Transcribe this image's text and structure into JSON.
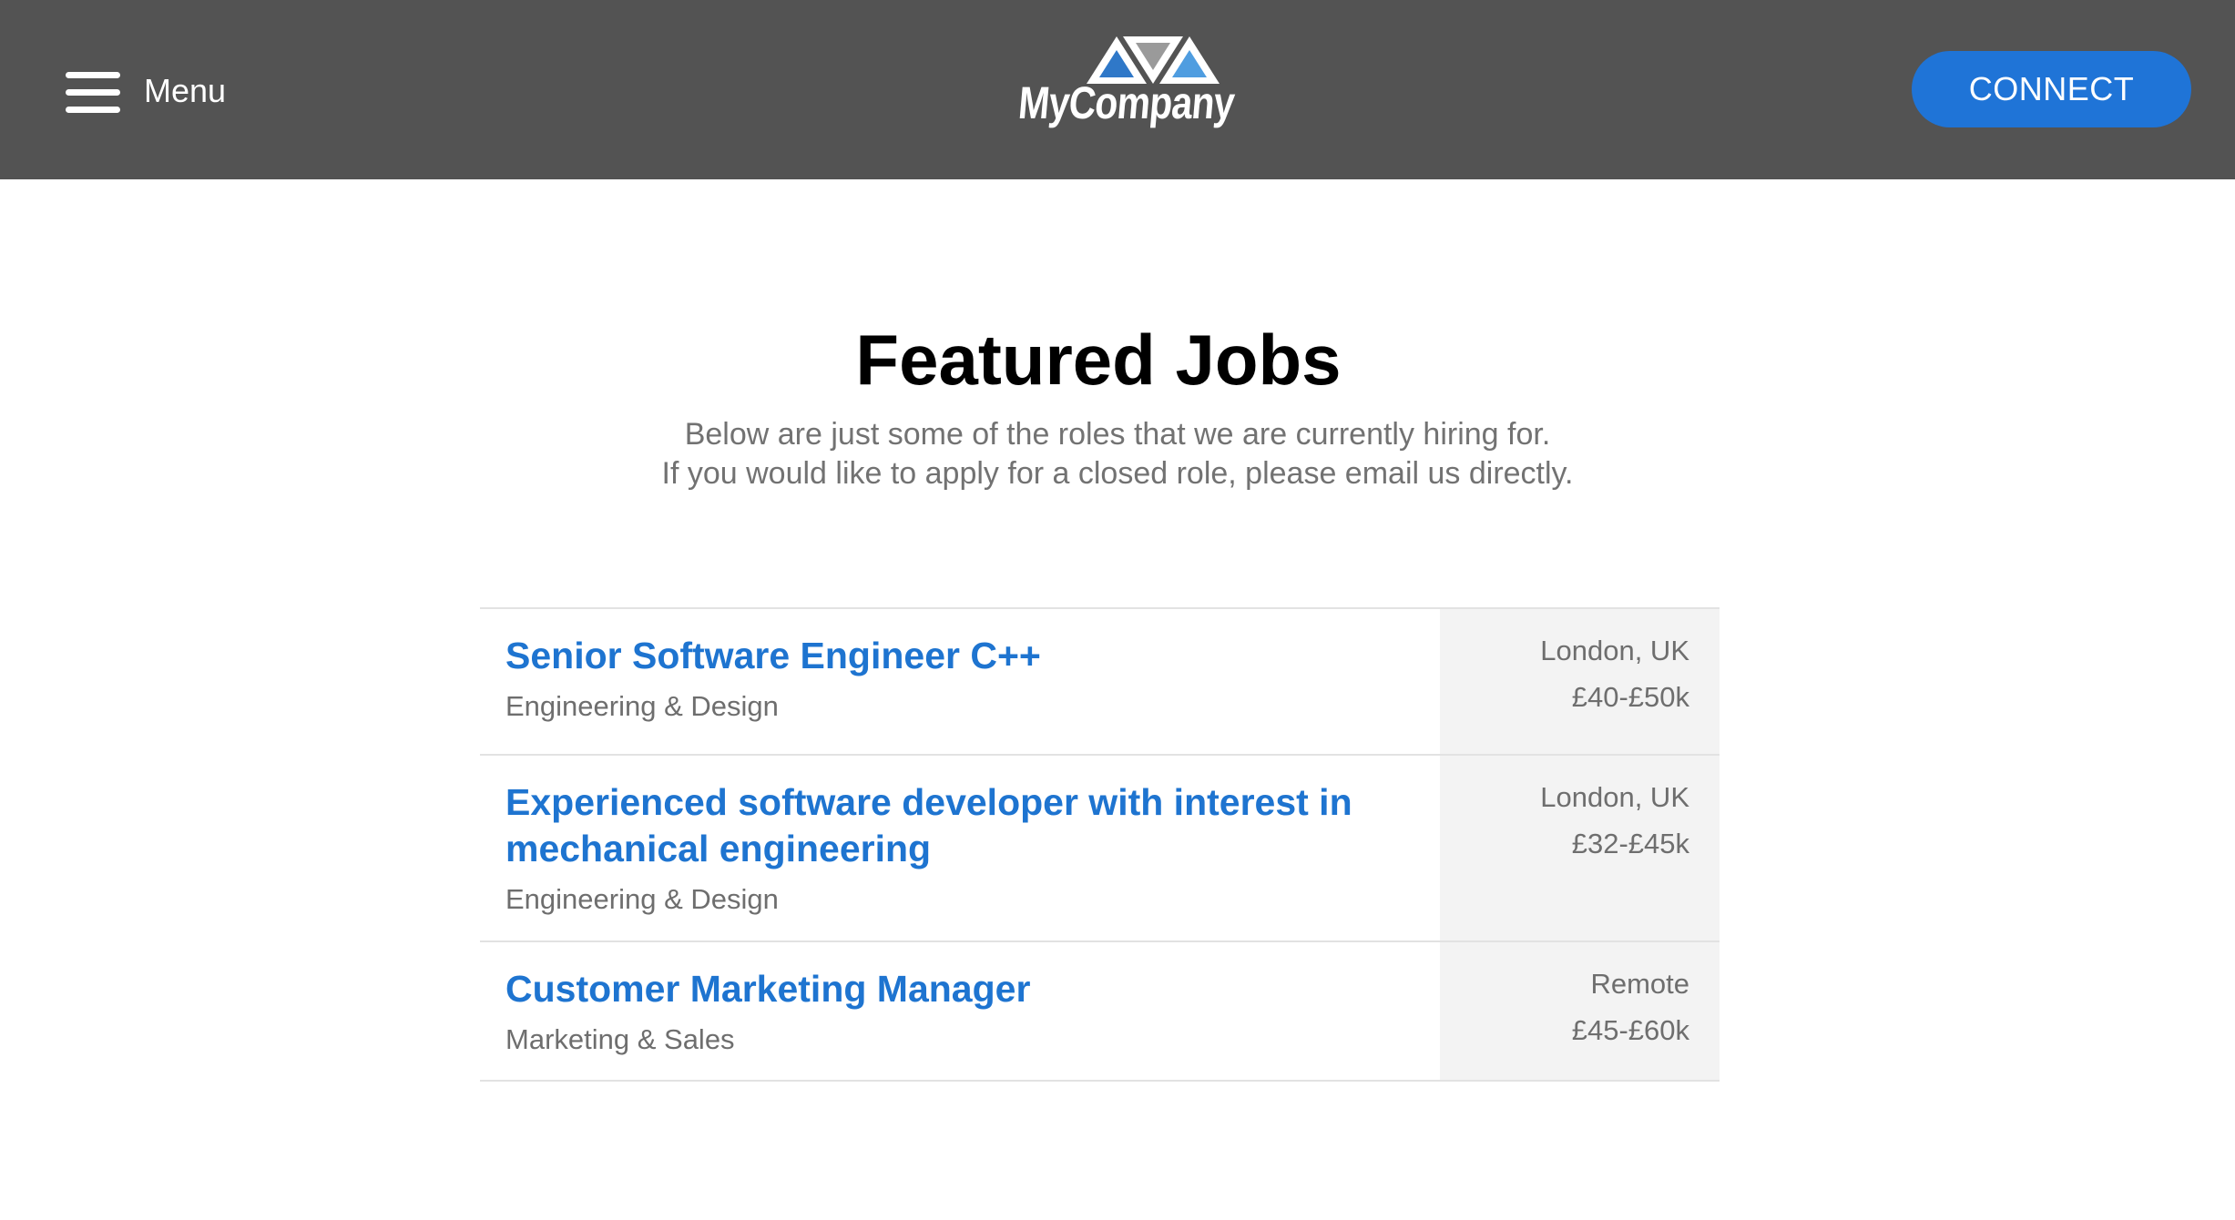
{
  "header": {
    "menu_label": "Menu",
    "logo_text": "MyCompany",
    "connect_label": "CONNECT"
  },
  "main": {
    "title": "Featured Jobs",
    "subtitle_line1": "Below are just some of the roles that we are currently hiring for.",
    "subtitle_line2": "If you would like to apply for a closed role, please email us directly."
  },
  "jobs": [
    {
      "title": "Senior Software Engineer C++",
      "department": "Engineering & Design",
      "location": "London, UK",
      "salary": "£40-£50k"
    },
    {
      "title": "Experienced software developer with interest in mechanical engineering",
      "department": "Engineering & Design",
      "location": "London, UK",
      "salary": "£32-£45k"
    },
    {
      "title": "Customer Marketing Manager",
      "department": "Marketing & Sales",
      "location": "Remote",
      "salary": "£45-£60k"
    }
  ],
  "colors": {
    "header_bg": "#535353",
    "accent": "#1f74d7",
    "job_title": "#1e74d0",
    "meta_bg": "#f3f3f3"
  },
  "icons": {
    "menu": "hamburger-icon",
    "logo": "triangle-logo-icon"
  }
}
